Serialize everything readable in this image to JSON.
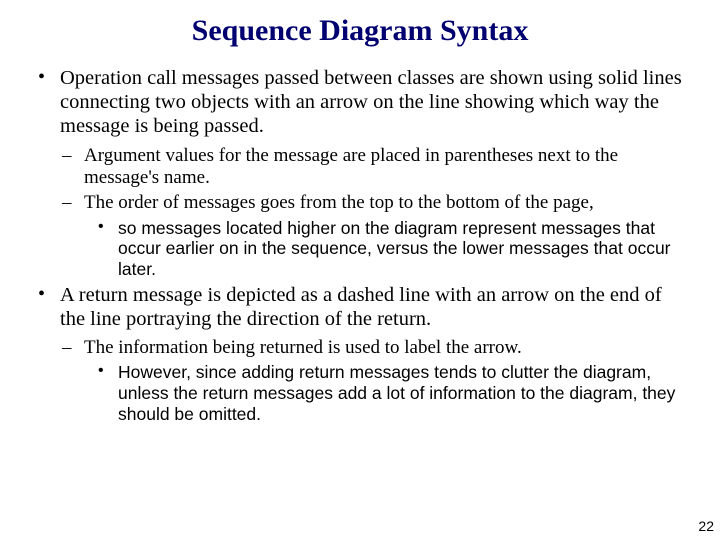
{
  "title": "Sequence Diagram Syntax",
  "bullets": {
    "b1": "Operation call messages passed between classes are shown using solid lines connecting two objects with an arrow on the line showing which way the message is being passed.",
    "b1a": "Argument values for the message are placed in parentheses next to the message's name.",
    "b1b": "The order of messages goes from the top to the bottom of the page,",
    "b1b1": "so messages located higher on the diagram represent messages that occur earlier on in the sequence, versus the lower messages that occur later.",
    "b2": "A return message is depicted as a dashed line with an arrow on the end of the line portraying the direction of the return.",
    "b2a": "The information being returned is used to label the arrow.",
    "b2a1": "However, since adding return messages tends to clutter the diagram, unless the return messages add a lot of information to the diagram, they should be omitted."
  },
  "pageNumber": "22"
}
